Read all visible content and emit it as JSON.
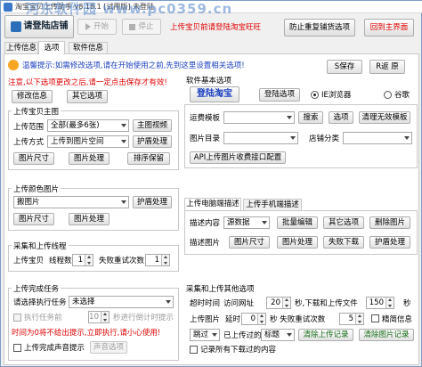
{
  "title": "淘宝宝贝上传助手 v8.18.1 [试用版] 未登陆",
  "watermark": "河东软件园 www.pc0359.cn",
  "toolbar": {
    "login_store": "请登陆店铺",
    "start": "开始",
    "stop": "停止",
    "notice": "上传宝贝前请登陆淘宝旺旺",
    "prevent_repeat": "防止重复铺货选项",
    "back_home": "回到主界面"
  },
  "tabs": {
    "upload_info": "上传信息",
    "options": "选项",
    "software_info": "软件信息"
  },
  "tip": "温馨提示:如需修改选项,请在开始使用之前,先到这里设置相关选项!",
  "save": "S保存",
  "return": "R返 原",
  "notice_red": "注意,以下选项更改之后,请一定点击保存才有效!",
  "modify_options": "修改信息",
  "other_options": "其它选项",
  "main_group": {
    "title": "上传宝贝主图",
    "range_label": "上传范围",
    "range_value": "全部(最多6张)",
    "main_video": "主图视频",
    "mode_label": "上传方式",
    "mode_value": "上传到图片空间",
    "shield": "护盾处理",
    "image_size": "图片尺寸",
    "image_process": "图片处理",
    "sort_keep": "排序保留"
  },
  "color_group": {
    "title": "上传颜色图片",
    "value": "搬图片",
    "shield": "护盾处理",
    "image_size": "图片尺寸",
    "image_process": "图片处理"
  },
  "thread_group": {
    "title": "采集和上传线程",
    "label": "上传宝贝",
    "threads_label": "线程数",
    "threads": "1",
    "retry_label": "失败重试次数",
    "retry": "1"
  },
  "task_group": {
    "title": "上传完成任务",
    "select_label": "请选择执行任务",
    "select_value": "未选择",
    "exec_label": "执行任务前",
    "exec_value": "10",
    "countdown": "秒进行倒计时提示",
    "warning": "时间为0将不给出提示,立即执行,请小心使用!",
    "sound": "上传完成声音提示",
    "sound_options": "声音选项"
  },
  "software_base": {
    "title": "软件基本选项",
    "login_taobao": "登陆淘宝",
    "login_options": "登陆选项",
    "ie_browser": "IE浏览器",
    "chrome": "谷歌"
  },
  "shipping": {
    "template_label": "运费模板",
    "search": "搜索",
    "options": "选项",
    "clear_invalid": "清理无效模板",
    "image_dir_label": "图片目录",
    "store_category_label": "店铺分类",
    "api_config": "API上传图片收费接口配置"
  },
  "desc_tabs": {
    "pc": "上传电脑端描述",
    "mobile": "上传手机端描述"
  },
  "desc": {
    "content_label": "描述内容",
    "content_value": "源数据",
    "batch_edit": "批量编辑",
    "other_options": "其它选项",
    "delete_image": "删除图片",
    "image_label": "描述图片",
    "image_size": "图片尺寸",
    "image_process": "图片处理",
    "fail_retry": "失败下载",
    "shield": "护盾处理"
  },
  "collect": {
    "title": "采集和上传其他选项",
    "timeout_label": "超时时间",
    "visit_label": "访问网址",
    "visit_value": "20",
    "seconds": "秒,下载和上传文件",
    "file_value": "150",
    "seconds2": "秒",
    "upload_image": "上传图片",
    "delay_label": "延时",
    "delay_value": "0",
    "retry_label": "秒 失败重试次数",
    "retry_value": "5",
    "precise": "精简信息",
    "skip_value": "跳过",
    "uploaded": "已上传过的",
    "title_value": "标题",
    "clear_upload": "清除上传记录",
    "clear_image": "清除图片记录",
    "record_all": "记录所有下载过的内容"
  }
}
